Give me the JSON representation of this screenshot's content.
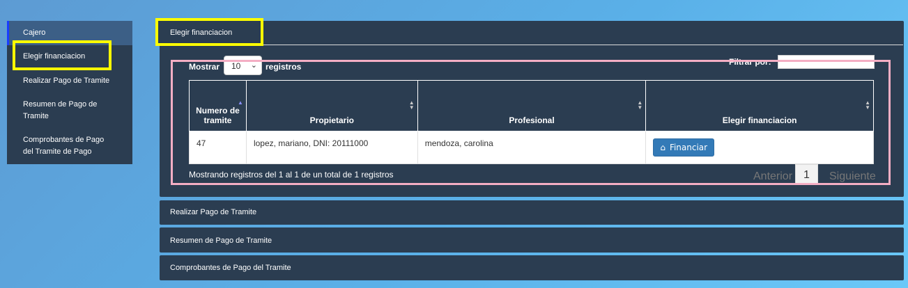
{
  "sidebar": {
    "items": [
      {
        "label": "Cajero"
      },
      {
        "label": "Elegir financiacion"
      },
      {
        "label": "Realizar Pago de Tramite"
      },
      {
        "label": "Resumen de Pago de Tramite"
      },
      {
        "label": "Comprobantes de Pago del Tramite de Pago"
      }
    ]
  },
  "panels": {
    "active_title": "Elegir financiacion",
    "realizar": "Realizar Pago de Tramite",
    "resumen": "Resumen de Pago de Tramite",
    "comprobantes": "Comprobantes de Pago del Tramite"
  },
  "table_controls": {
    "show_prefix": "Mostrar",
    "page_length": "10",
    "show_suffix": "registros",
    "filter_label": "Filtrar por:",
    "filter_value": ""
  },
  "table": {
    "headers": [
      "Numero de tramite",
      "Propietario",
      "Profesional",
      "Elegir financiacion"
    ],
    "rows": [
      {
        "numero": "47",
        "propietario": "lopez, mariano, DNI: 20111000",
        "profesional": "mendoza, carolina",
        "action": "Financiar"
      }
    ]
  },
  "footer": {
    "info": "Mostrando registros del 1 al 1 de un total de 1 registros",
    "prev": "Anterior",
    "page": "1",
    "next": "Siguiente"
  },
  "colors": {
    "panel": "#2b3d51",
    "highlight_yellow": "#ffff00",
    "highlight_pink": "#f4aec4",
    "button": "#337ab7"
  }
}
